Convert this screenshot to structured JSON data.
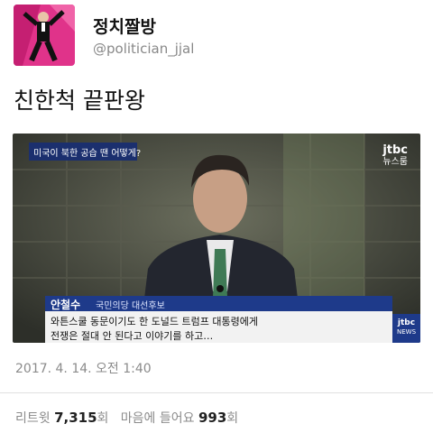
{
  "account": {
    "display_name": "정치짤방",
    "handle": "@politician_jjal"
  },
  "tweet": {
    "text": "친한척 끝판왕",
    "timestamp": "2017. 4. 14. 오전 1:40"
  },
  "video": {
    "top_caption": "미국이 북한 공습 땐 어떻게?",
    "logo_main": "jtbc",
    "logo_sub": "뉴스룸",
    "name": "안철수",
    "role": "국민의당 대선후보",
    "subtitle_line1": "와튼스쿨 동문이기도 한 도널드 트럼프 대통령에게",
    "subtitle_line2": "전쟁은 절대 안 된다고 이야기를 하고…",
    "corner_logo": "jtbc",
    "corner_sub": "NEWS"
  },
  "stats": {
    "retweets_label": "리트윗",
    "retweets_count": "7,315",
    "retweets_unit": "회",
    "likes_label": "마음에 들어요",
    "likes_count": "993",
    "likes_unit": "회"
  },
  "colors": {
    "caption_bar": "#1b2f6e",
    "subtitle_bar": "#f2f2f2",
    "name_bar": "#1e3a8a"
  }
}
